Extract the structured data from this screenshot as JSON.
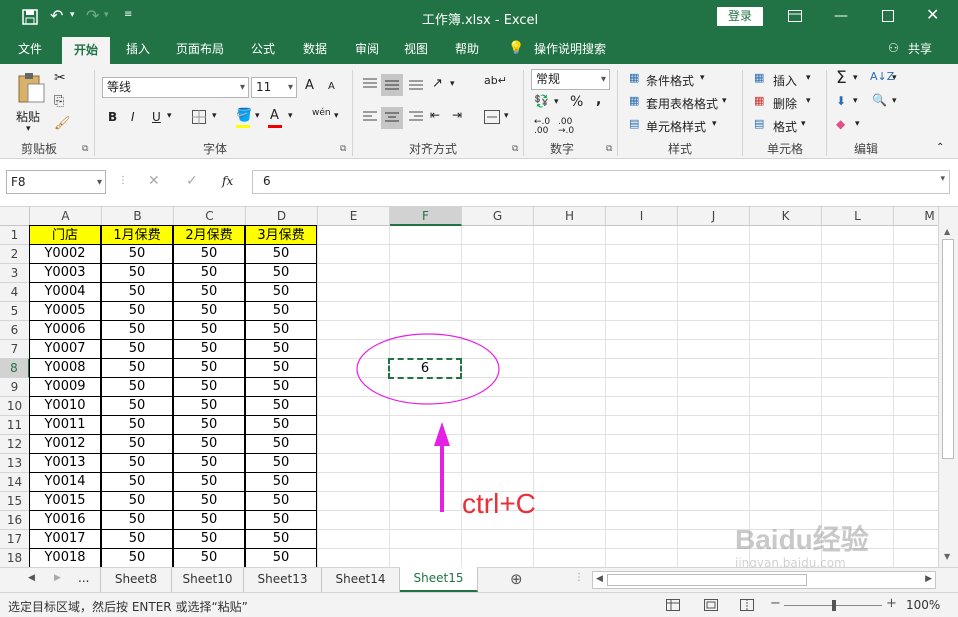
{
  "titlebar": {
    "title": "工作簿.xlsx  -  Excel",
    "login": "登录"
  },
  "tabs": [
    "文件",
    "开始",
    "插入",
    "页面布局",
    "公式",
    "数据",
    "审阅",
    "视图",
    "帮助",
    "操作说明搜索"
  ],
  "share": "共享",
  "ribbon": {
    "clipboard": {
      "paste": "粘贴",
      "label": "剪贴板"
    },
    "font": {
      "name": "等线",
      "size": "11",
      "label": "字体",
      "bold": "B",
      "italic": "I",
      "underline": "U",
      "grow": "A",
      "shrink": "A",
      "fontcolor": "A",
      "phonetic": "wén"
    },
    "alignment": {
      "label": "对齐方式"
    },
    "number": {
      "format": "常规",
      "percent": "%",
      "comma": ",",
      "inc": "←.0\n.00",
      "dec": ".00\n→.0",
      "label": "数字"
    },
    "styles": {
      "cond": "条件格式",
      "table": "套用表格格式",
      "cell": "单元格样式",
      "label": "样式"
    },
    "cells": {
      "insert": "插入",
      "delete": "删除",
      "format": "格式",
      "label": "单元格"
    },
    "editing": {
      "label": "编辑"
    }
  },
  "formula": {
    "namebox": "F8",
    "fx": "fx",
    "value": "6"
  },
  "columns": [
    "A",
    "B",
    "C",
    "D",
    "E",
    "F",
    "G",
    "H",
    "I",
    "J",
    "K",
    "L",
    "M"
  ],
  "rows": [
    "1",
    "2",
    "3",
    "4",
    "5",
    "6",
    "7",
    "8",
    "9",
    "10",
    "11",
    "12",
    "13",
    "14",
    "15",
    "16",
    "17",
    "18"
  ],
  "table": {
    "headers": [
      "门店",
      "1月保费",
      "2月保费",
      "3月保费"
    ],
    "stores": [
      "Y0002",
      "Y0003",
      "Y0004",
      "Y0005",
      "Y0006",
      "Y0007",
      "Y0008",
      "Y0009",
      "Y0010",
      "Y0011",
      "Y0012",
      "Y0013",
      "Y0014",
      "Y0015",
      "Y0016",
      "Y0017",
      "Y0018"
    ],
    "value": "50"
  },
  "f8": "6",
  "annotation": "ctrl+C",
  "sheets": {
    "more": "...",
    "names": [
      "Sheet8",
      "Sheet10",
      "Sheet13",
      "Sheet14",
      "Sheet15"
    ],
    "active": "Sheet15"
  },
  "status": {
    "message": "选定目标区域，然后按 ENTER 或选择“粘贴”",
    "zoom": "100%"
  },
  "watermark": {
    "line1": "Baidu经验",
    "line2": "jingyan.baidu.com"
  },
  "colors": {
    "excel_green": "#217346",
    "header_fill": "#ffff00",
    "annotation": "#e61fe6",
    "annotation_text": "#e8303a"
  }
}
